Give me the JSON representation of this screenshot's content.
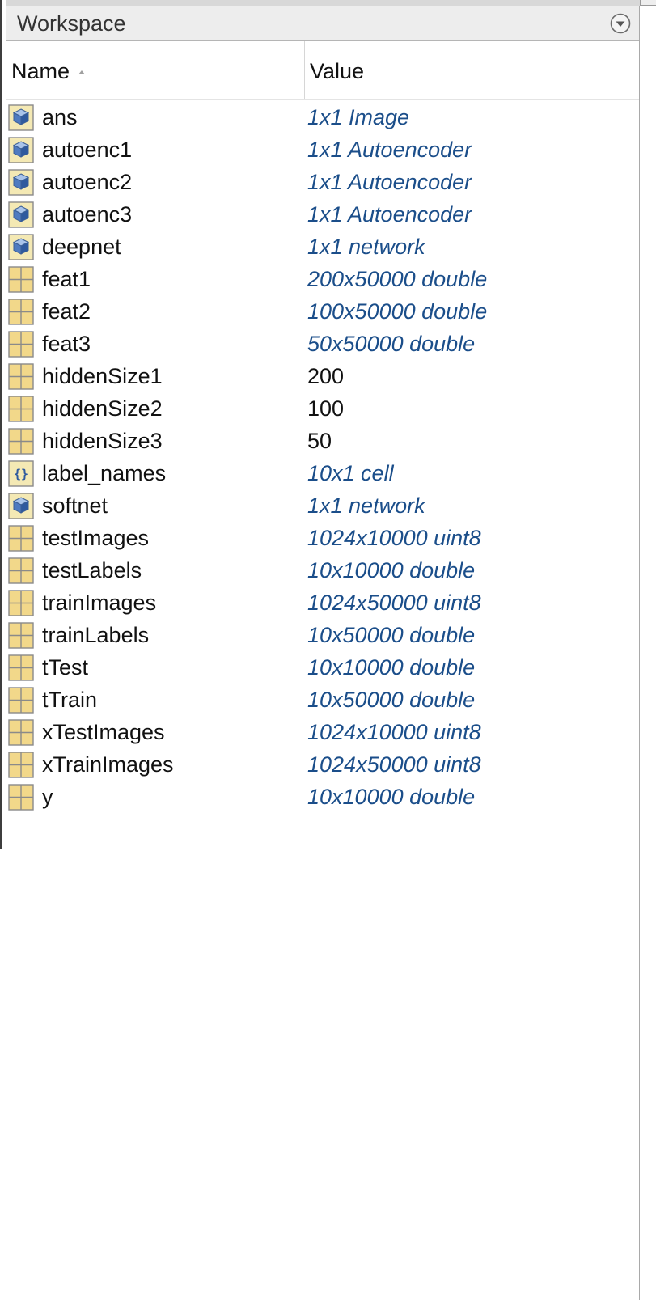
{
  "panel": {
    "title": "Workspace",
    "menu_icon": "chevron-down-circle-icon"
  },
  "columns": {
    "name": "Name",
    "value": "Value",
    "sort_icon": "sort-ascending-icon"
  },
  "colors": {
    "object_value": "#1b4e8a",
    "scalar_value": "#111111",
    "header_bg": "#ededed",
    "matrix_icon": "#f2d88a",
    "object_icon": "#4f7bc0"
  },
  "variables": [
    {
      "name": "ans",
      "value": "1x1 Image",
      "icon": "object-icon",
      "kind": "object"
    },
    {
      "name": "autoenc1",
      "value": "1x1 Autoencoder",
      "icon": "object-icon",
      "kind": "object"
    },
    {
      "name": "autoenc2",
      "value": "1x1 Autoencoder",
      "icon": "object-icon",
      "kind": "object"
    },
    {
      "name": "autoenc3",
      "value": "1x1 Autoencoder",
      "icon": "object-icon",
      "kind": "object"
    },
    {
      "name": "deepnet",
      "value": "1x1 network",
      "icon": "object-icon",
      "kind": "object"
    },
    {
      "name": "feat1",
      "value": "200x50000 double",
      "icon": "matrix-icon",
      "kind": "object"
    },
    {
      "name": "feat2",
      "value": "100x50000 double",
      "icon": "matrix-icon",
      "kind": "object"
    },
    {
      "name": "feat3",
      "value": "50x50000 double",
      "icon": "matrix-icon",
      "kind": "object"
    },
    {
      "name": "hiddenSize1",
      "value": "200",
      "icon": "matrix-icon",
      "kind": "scalar"
    },
    {
      "name": "hiddenSize2",
      "value": "100",
      "icon": "matrix-icon",
      "kind": "scalar"
    },
    {
      "name": "hiddenSize3",
      "value": "50",
      "icon": "matrix-icon",
      "kind": "scalar"
    },
    {
      "name": "label_names",
      "value": "10x1 cell",
      "icon": "cell-icon",
      "kind": "object"
    },
    {
      "name": "softnet",
      "value": "1x1 network",
      "icon": "object-icon",
      "kind": "object"
    },
    {
      "name": "testImages",
      "value": "1024x10000 uint8",
      "icon": "matrix-icon",
      "kind": "object"
    },
    {
      "name": "testLabels",
      "value": "10x10000 double",
      "icon": "matrix-icon",
      "kind": "object"
    },
    {
      "name": "trainImages",
      "value": "1024x50000 uint8",
      "icon": "matrix-icon",
      "kind": "object"
    },
    {
      "name": "trainLabels",
      "value": "10x50000 double",
      "icon": "matrix-icon",
      "kind": "object"
    },
    {
      "name": "tTest",
      "value": "10x10000 double",
      "icon": "matrix-icon",
      "kind": "object"
    },
    {
      "name": "tTrain",
      "value": "10x50000 double",
      "icon": "matrix-icon",
      "kind": "object"
    },
    {
      "name": "xTestImages",
      "value": "1024x10000 uint8",
      "icon": "matrix-icon",
      "kind": "object"
    },
    {
      "name": "xTrainImages",
      "value": "1024x50000 uint8",
      "icon": "matrix-icon",
      "kind": "object"
    },
    {
      "name": "y",
      "value": "10x10000 double",
      "icon": "matrix-icon",
      "kind": "object"
    }
  ]
}
